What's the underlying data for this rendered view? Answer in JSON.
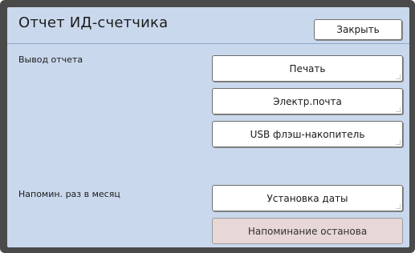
{
  "header": {
    "title": "Отчет ИД-счетчика",
    "close_label": "Закрыть"
  },
  "report_output": {
    "label": "Вывод отчета",
    "print_label": "Печать",
    "email_label": "Электр.почта",
    "usb_label": "USB флэш-накопитель"
  },
  "monthly_reminder": {
    "label": "Напомин. раз в месяц",
    "set_date_label": "Установка даты",
    "stop_reminder_label": "Напоминание останова"
  },
  "colors": {
    "screen_bg": "#c9d8ec",
    "button_bg": "#ffffff",
    "disabled_button_bg": "#e8d7d7",
    "bezel": "#4a4a4a"
  }
}
